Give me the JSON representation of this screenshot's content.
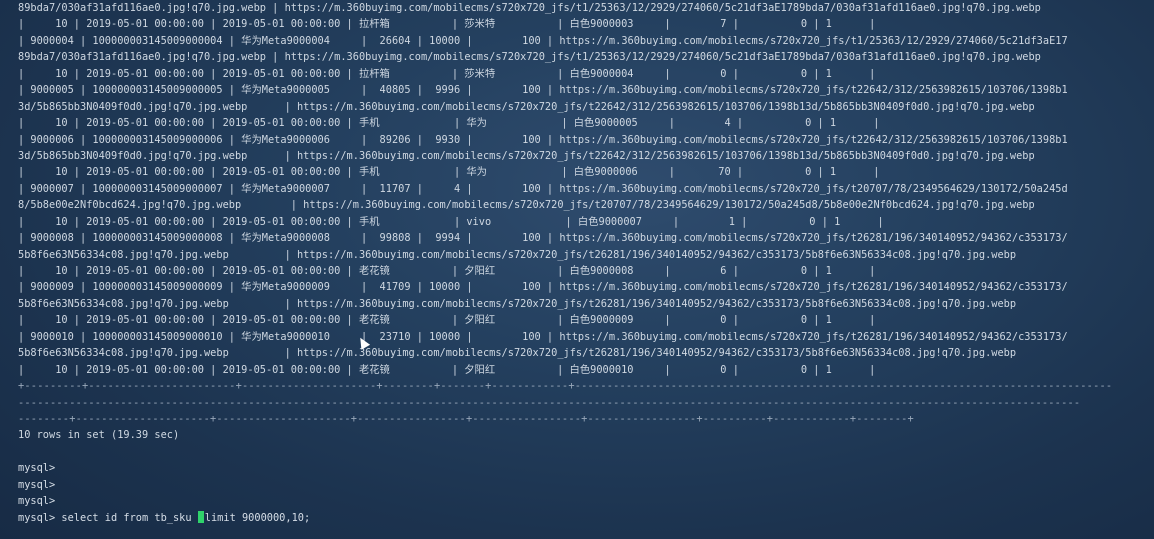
{
  "terminal": {
    "lines": [
      "89bda7/030af31afd116ae0.jpg!q70.jpg.webp | https://m.360buyimg.com/mobilecms/s720x720_jfs/t1/25363/12/2929/274060/5c21df3aE1789bda7/030af31afd116ae0.jpg!q70.jpg.webp",
      "|     10 | 2019-05-01 00:00:00 | 2019-05-01 00:00:00 | 拉杆箱          | 莎米特          | 白色9000003     |        7 |          0 | 1      |",
      "| 9000004 | 100000003145009000004 | 华为Meta9000004     |  26604 | 10000 |        100 | https://m.360buyimg.com/mobilecms/s720x720_jfs/t1/25363/12/2929/274060/5c21df3aE17",
      "89bda7/030af31afd116ae0.jpg!q70.jpg.webp | https://m.360buyimg.com/mobilecms/s720x720_jfs/t1/25363/12/2929/274060/5c21df3aE1789bda7/030af31afd116ae0.jpg!q70.jpg.webp",
      "|     10 | 2019-05-01 00:00:00 | 2019-05-01 00:00:00 | 拉杆箱          | 莎米特          | 白色9000004     |        0 |          0 | 1      |",
      "| 9000005 | 100000003145009000005 | 华为Meta9000005     |  40805 |  9996 |        100 | https://m.360buyimg.com/mobilecms/s720x720_jfs/t22642/312/2563982615/103706/1398b1",
      "3d/5b865bb3N0409f0d0.jpg!q70.jpg.webp      | https://m.360buyimg.com/mobilecms/s720x720_jfs/t22642/312/2563982615/103706/1398b13d/5b865bb3N0409f0d0.jpg!q70.jpg.webp",
      "|     10 | 2019-05-01 00:00:00 | 2019-05-01 00:00:00 | 手机            | 华为            | 白色9000005     |        4 |          0 | 1      |",
      "| 9000006 | 100000003145009000006 | 华为Meta9000006     |  89206 |  9930 |        100 | https://m.360buyimg.com/mobilecms/s720x720_jfs/t22642/312/2563982615/103706/1398b1",
      "3d/5b865bb3N0409f0d0.jpg!q70.jpg.webp      | https://m.360buyimg.com/mobilecms/s720x720_jfs/t22642/312/2563982615/103706/1398b13d/5b865bb3N0409f0d0.jpg!q70.jpg.webp",
      "|     10 | 2019-05-01 00:00:00 | 2019-05-01 00:00:00 | 手机            | 华为            | 白色9000006     |       70 |          0 | 1      |",
      "| 9000007 | 100000003145009000007 | 华为Meta9000007     |  11707 |     4 |        100 | https://m.360buyimg.com/mobilecms/s720x720_jfs/t20707/78/2349564629/130172/50a245d",
      "8/5b8e00e2Nf0bcd624.jpg!q70.jpg.webp        | https://m.360buyimg.com/mobilecms/s720x720_jfs/t20707/78/2349564629/130172/50a245d8/5b8e00e2Nf0bcd624.jpg!q70.jpg.webp",
      "|     10 | 2019-05-01 00:00:00 | 2019-05-01 00:00:00 | 手机            | vivo            | 白色9000007     |        1 |          0 | 1      |",
      "| 9000008 | 100000003145009000008 | 华为Meta9000008     |  99808 |  9994 |        100 | https://m.360buyimg.com/mobilecms/s720x720_jfs/t26281/196/340140952/94362/c353173/",
      "5b8f6e63N56334c08.jpg!q70.jpg.webp         | https://m.360buyimg.com/mobilecms/s720x720_jfs/t26281/196/340140952/94362/c353173/5b8f6e63N56334c08.jpg!q70.jpg.webp",
      "|     10 | 2019-05-01 00:00:00 | 2019-05-01 00:00:00 | 老花镜          | 夕阳红          | 白色9000008     |        6 |          0 | 1      |",
      "| 9000009 | 100000003145009000009 | 华为Meta9000009     |  41709 | 10000 |        100 | https://m.360buyimg.com/mobilecms/s720x720_jfs/t26281/196/340140952/94362/c353173/",
      "5b8f6e63N56334c08.jpg!q70.jpg.webp         | https://m.360buyimg.com/mobilecms/s720x720_jfs/t26281/196/340140952/94362/c353173/5b8f6e63N56334c08.jpg!q70.jpg.webp",
      "|     10 | 2019-05-01 00:00:00 | 2019-05-01 00:00:00 | 老花镜          | 夕阳红          | 白色9000009     |        0 |          0 | 1      |",
      "| 9000010 | 100000003145009000010 | 华为Meta9000010     |  23710 | 10000 |        100 | https://m.360buyimg.com/mobilecms/s720x720_jfs/t26281/196/340140952/94362/c353173/",
      "5b8f6e63N56334c08.jpg!q70.jpg.webp         | https://m.360buyimg.com/mobilecms/s720x720_jfs/t26281/196/340140952/94362/c353173/5b8f6e63N56334c08.jpg!q70.jpg.webp",
      "|     10 | 2019-05-01 00:00:00 | 2019-05-01 00:00:00 | 老花镜          | 夕阳红          | 白色9000010     |        0 |          0 | 1      |"
    ],
    "separator_1": "+---------+-----------------------+---------------------+--------+-------+------------+------------------------------------------------------------------------------------",
    "separator_2": "----------------------------------------------------------------------------------------------------------------------------------------------------------------------",
    "separator_3": "--------+---------------------+---------------------+-----------------+-----------------+-----------------+----------+------------+--------+",
    "blank": "",
    "result_summary": "10 rows in set (19.39 sec)",
    "prompt_empty_1": "mysql>",
    "prompt_empty_2": "mysql>",
    "prompt_empty_3": "mysql>",
    "command_prefix": "mysql> select id from tb_sku ",
    "command_suffix": "limit 9000000,10;",
    "colors": {
      "background": "#1f3550",
      "text": "#cfd8e2",
      "cursor": "#2fd36b"
    }
  }
}
